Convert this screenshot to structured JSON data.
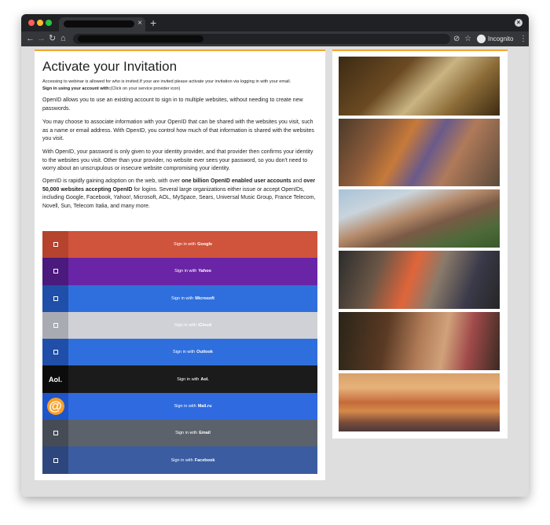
{
  "browser": {
    "incognito_label": "Incognito",
    "tab_close": "×",
    "new_tab": "+",
    "window_close": "×",
    "back": "←",
    "forward": "→",
    "reload": "↻",
    "home": "⌂",
    "menu": "⋮"
  },
  "page": {
    "title": "Activate your Invitation",
    "intro_line": "Accessing to webinar is allowed for who is invited.If your are invited please activate your invitation via logging in with your email.",
    "intro_bold": "Sign in using your account with:",
    "intro_tail": "(Click on your service provider icon)",
    "para1": "OpenID allows you to use an existing account to sign in to multiple websites, without needing to create new passwords.",
    "para2": "You may choose to associate information with your OpenID that can be shared with the websites you visit, such as a name or email address. With OpenID, you control how much of that information is shared with the websites you visit.",
    "para3": "With OpenID, your password is only given to your identity provider, and that provider then confirms your identity to the websites you visit. Other than your provider, no website ever sees your password, so you don't need to worry about an unscrupulous or insecure website compromising your identity.",
    "para4_a": "OpenID is rapidly gaining adoption on the web, with over ",
    "para4_b": "one billion OpenID enabled user accounts",
    "para4_c": " and ",
    "para4_d": "over 50,000 websites accepting OpenID",
    "para4_e": " for logins. Several large organizations either issue or accept OpenIDs, including Google, Facebook, Yahoo!, Microsoft, AOL, MySpace, Sears, Universal Music Group, France Telecom, Novell, Sun, Telecom Italia, and many more."
  },
  "providers": [
    {
      "prefix": "Sign in with",
      "name": "Google",
      "icon_bg": "#b5432e",
      "bg": "#d0533b",
      "icon": "square-icon"
    },
    {
      "prefix": "Sign in with",
      "name": "Yahoo",
      "icon_bg": "#4a1a7c",
      "bg": "#6a25a6",
      "icon": "square-icon"
    },
    {
      "prefix": "Sign in with",
      "name": "Microsoft",
      "icon_bg": "#1f4fa8",
      "bg": "#2f6fdd",
      "icon": "square-icon"
    },
    {
      "prefix": "Sign in with",
      "name": "iCloud",
      "icon_bg": "#a9abb3",
      "bg": "#cfd1d6",
      "icon": "square-icon"
    },
    {
      "prefix": "Sign in with",
      "name": "Outlook",
      "icon_bg": "#1f4fa8",
      "bg": "#2f6fdd",
      "icon": "square-icon"
    },
    {
      "prefix": "Sign in with",
      "name": "Aol.",
      "icon_bg": "#0c0c0c",
      "bg": "#1b1b1b",
      "icon": "aol-logo",
      "logo_text": "Aol."
    },
    {
      "prefix": "Sign in with",
      "name": "Mail.ru",
      "icon_bg": "#1f55c8",
      "bg": "#2f6ae0",
      "icon": "mailru-at-icon",
      "logo_text": "@"
    },
    {
      "prefix": "Sign in with",
      "name": "Email",
      "icon_bg": "#464c55",
      "bg": "#5b626c",
      "icon": "square-icon"
    },
    {
      "prefix": "Sign in with",
      "name": "Facebook",
      "icon_bg": "#2d477e",
      "bg": "#3b5ca1",
      "icon": "square-icon"
    }
  ],
  "colors": {
    "accent": "#f2a531"
  }
}
